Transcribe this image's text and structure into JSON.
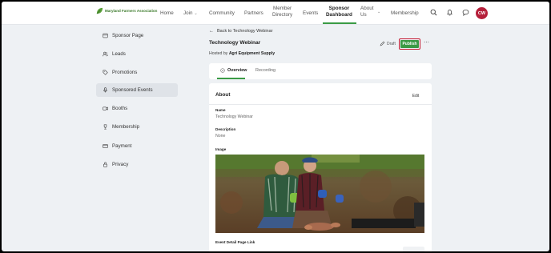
{
  "brand": {
    "logo_text": "Maryland Farmers Association",
    "accent": "#3a9b45",
    "primary_red": "#b51f3a"
  },
  "nav": {
    "home": "Home",
    "join": "Join",
    "community": "Community",
    "partners": "Partners",
    "member_directory_1": "Member",
    "member_directory_2": "Directory",
    "events": "Events",
    "sponsor_dashboard_1": "Sponsor",
    "sponsor_dashboard_2": "Dashboard",
    "about_us_1": "About",
    "about_us_2": "Us",
    "membership": "Membership",
    "avatar_initials": "CW"
  },
  "sidebar": {
    "items": [
      {
        "label": "Sponsor Page",
        "icon": "page-icon"
      },
      {
        "label": "Leads",
        "icon": "users-icon"
      },
      {
        "label": "Promotions",
        "icon": "tag-icon"
      },
      {
        "label": "Sponsored Events",
        "icon": "microphone-icon"
      },
      {
        "label": "Booths",
        "icon": "video-icon"
      },
      {
        "label": "Membership",
        "icon": "trophy-icon"
      },
      {
        "label": "Payment",
        "icon": "credit-card-icon"
      },
      {
        "label": "Privacy",
        "icon": "lock-icon"
      }
    ]
  },
  "main": {
    "back_label": "Back to Technology Webinar",
    "title": "Technology Webinar",
    "hosted_prefix": "Hosted by",
    "hosted_by": "Agri Equipment Supply",
    "draft_label": "Draft",
    "publish_label": "Publish",
    "tabs": [
      {
        "label": "Overview"
      },
      {
        "label": "Recording"
      }
    ],
    "about": {
      "heading": "About",
      "edit_label": "Edit",
      "name_label": "Name",
      "name_value": "Technology Webinar",
      "description_label": "Description",
      "description_value": "None",
      "image_label": "Image",
      "link_label": "Event Detail Page Link"
    }
  }
}
